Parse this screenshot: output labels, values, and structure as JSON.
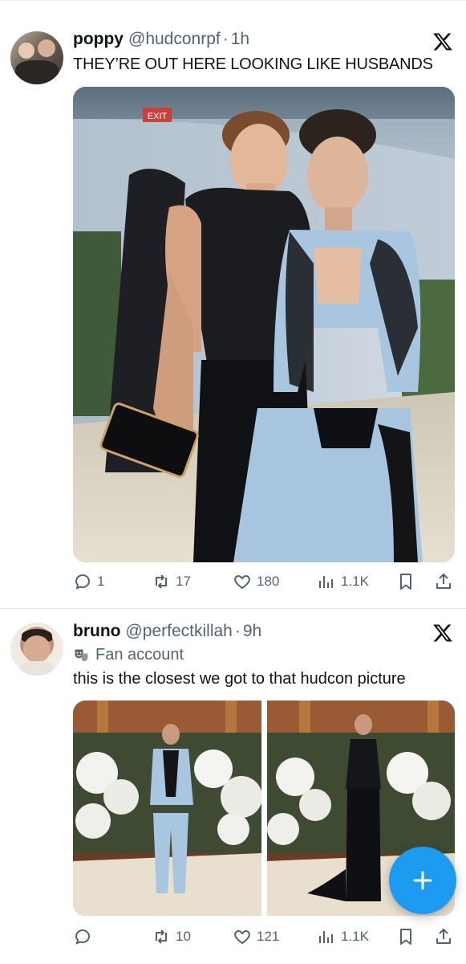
{
  "tweets": [
    {
      "name": "poppy",
      "handle": "@hudconrpf",
      "sep": "·",
      "time": "1h",
      "text": "THEY’RE OUT HERE LOOKING LIKE HUSBANDS",
      "stats": {
        "replies": "1",
        "reposts": "17",
        "likes": "180",
        "views": "1.1K"
      },
      "media_sign": "EXIT"
    },
    {
      "name": "bruno",
      "handle": "@perfectkillah",
      "sep": "·",
      "time": "9h",
      "badge": "Fan account",
      "text": "this is the closest we got to that hudcon picture",
      "stats": {
        "replies": "",
        "reposts": "10",
        "likes": "121",
        "views": "1.1K"
      }
    }
  ],
  "colors": {
    "accent": "#1d9bf0",
    "secondary_text": "#536471",
    "divider": "#e6ecf0"
  }
}
